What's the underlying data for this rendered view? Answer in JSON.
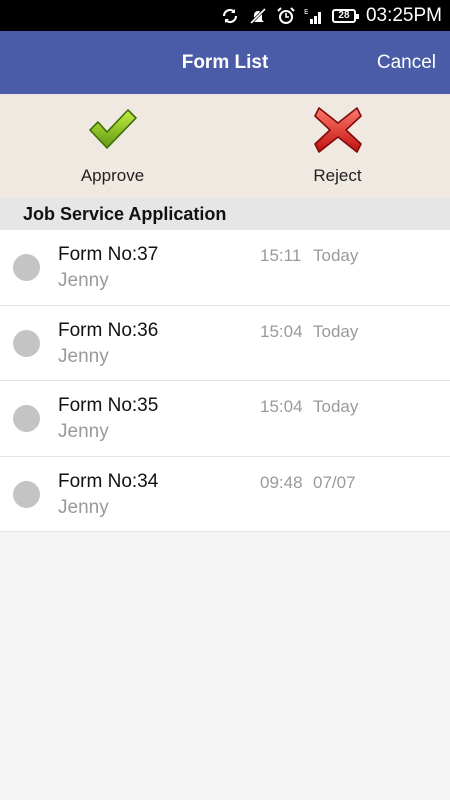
{
  "status_bar": {
    "time": "03:25PM",
    "battery": "28",
    "icons": [
      "sync-icon",
      "mute-icon",
      "alarm-icon",
      "signal-icon",
      "battery-icon"
    ]
  },
  "header": {
    "title": "Form List",
    "cancel_label": "Cancel",
    "color": "#4a5ca8"
  },
  "actions": {
    "approve_label": "Approve",
    "reject_label": "Reject"
  },
  "section": {
    "title": "Job Service Application"
  },
  "forms": [
    {
      "form_no": "Form No:37",
      "applicant": "Jenny",
      "time": "15:11",
      "date": "Today"
    },
    {
      "form_no": "Form No:36",
      "applicant": "Jenny",
      "time": "15:04",
      "date": "Today"
    },
    {
      "form_no": "Form No:35",
      "applicant": "Jenny",
      "time": "15:04",
      "date": "Today"
    },
    {
      "form_no": "Form No:34",
      "applicant": "Jenny",
      "time": "09:48",
      "date": "07/07"
    }
  ]
}
